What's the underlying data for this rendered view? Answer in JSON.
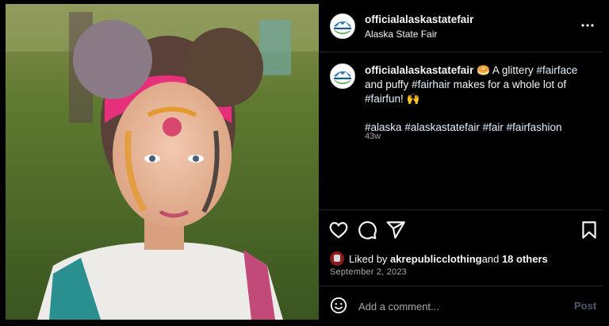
{
  "header": {
    "username": "officialalaskastatefair",
    "subtitle": "Alaska State Fair",
    "more_icon": "more-horizontal-icon"
  },
  "caption": {
    "username": "officialalaskastatefair",
    "emoji1": "🥯",
    "text_a": " A glittery ",
    "tag_fairface": "#fairface",
    "text_b": " and puffy ",
    "tag_fairhair": "#fairhair",
    "text_c": " makes for a whole lot of ",
    "tag_fairfun": "#fairfun",
    "text_d": "! ",
    "emoji2": "🙌",
    "tag_alaska": "#alaska",
    "tag_alaskastatefair": "#alaskastatefair",
    "tag_fair": "#fair",
    "tag_fairfashion": "#fairfashion",
    "age": "43w"
  },
  "actions": {
    "icons": [
      "heart-icon",
      "comment-icon",
      "share-icon",
      "bookmark-icon"
    ]
  },
  "likes": {
    "prefix": "Liked by ",
    "user": "akrepublicclothing",
    "middle": " and ",
    "others": "18 others"
  },
  "date": "September 2, 2023",
  "comment": {
    "placeholder": "Add a comment...",
    "post_label": "Post"
  },
  "colors": {
    "background": "#000000",
    "text": "#f5f5f5",
    "secondary": "#a8a8a8",
    "hashtag": "#e0f1ff",
    "post_disabled": "#52586c"
  }
}
